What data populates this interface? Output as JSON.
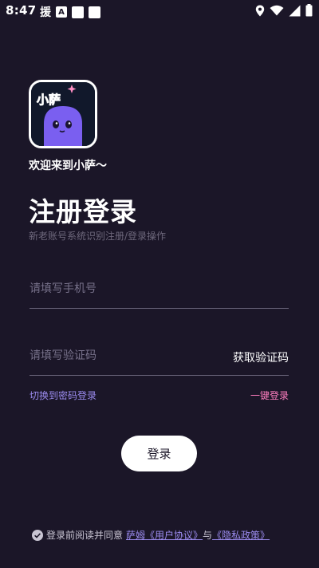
{
  "status_bar": {
    "time": "8:47",
    "notification_glyph": "援",
    "badge_letter": "A",
    "icons": [
      "location-icon",
      "wifi-icon",
      "signal-icon",
      "battery-icon"
    ]
  },
  "logo": {
    "text": "小萨"
  },
  "welcome": "欢迎来到小萨～",
  "title": "注册登录",
  "subtitle": "新老账号系统识别注册/登录操作",
  "phone_field": {
    "value": "",
    "placeholder": "请填写手机号"
  },
  "code_field": {
    "value": "",
    "placeholder": "请填写验证码",
    "get_code_label": "获取验证码"
  },
  "switch_password_login": "切换到密码登录",
  "one_click_login": "一键登录",
  "login_button": "登录",
  "agreement": {
    "prefix": "登录前阅读并同意",
    "user_agreement": "萨姆《用户协议》",
    "and": "与",
    "privacy_policy": "《隐私政策》"
  },
  "colors": {
    "background": "#1b1628",
    "accent_purple": "#9c8cf0",
    "accent_pink": "#ff7fc0"
  }
}
